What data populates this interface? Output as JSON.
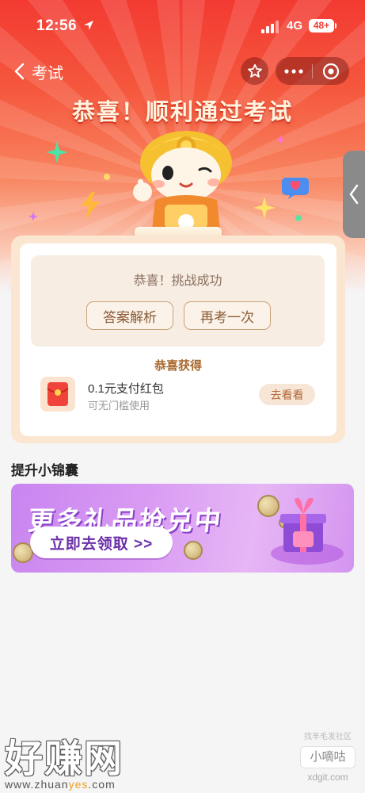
{
  "status_bar": {
    "time": "12:56",
    "network": "4G",
    "battery": "48+"
  },
  "nav": {
    "back_label": "考试"
  },
  "hero": {
    "title": "恭喜！顺利通过考试"
  },
  "result": {
    "challenge_text": "恭喜！挑战成功",
    "answers_button": "答案解析",
    "retry_button": "再考一次",
    "gain_title": "恭喜获得",
    "reward": {
      "name": "0.1元支付红包",
      "desc": "可无门槛使用",
      "action": "去看看"
    }
  },
  "section": {
    "title": "提升小锦囊"
  },
  "banner": {
    "title": "更多礼品抢兑中",
    "button": "立即去领取 >>"
  },
  "watermarks": {
    "left_big": "好赚网",
    "left_url_a": "www.zhuan",
    "left_url_b": "yes",
    "left_url_c": ".com",
    "right_small": "找羊毛发社区",
    "right_box": "小嘀咕",
    "right_domain": "xdgit.com"
  },
  "colors": {
    "hero_red": "#f33a32",
    "card_beige": "#fbe7d1",
    "accent_brown": "#8a5a36",
    "banner_purple": "#c985f0"
  }
}
